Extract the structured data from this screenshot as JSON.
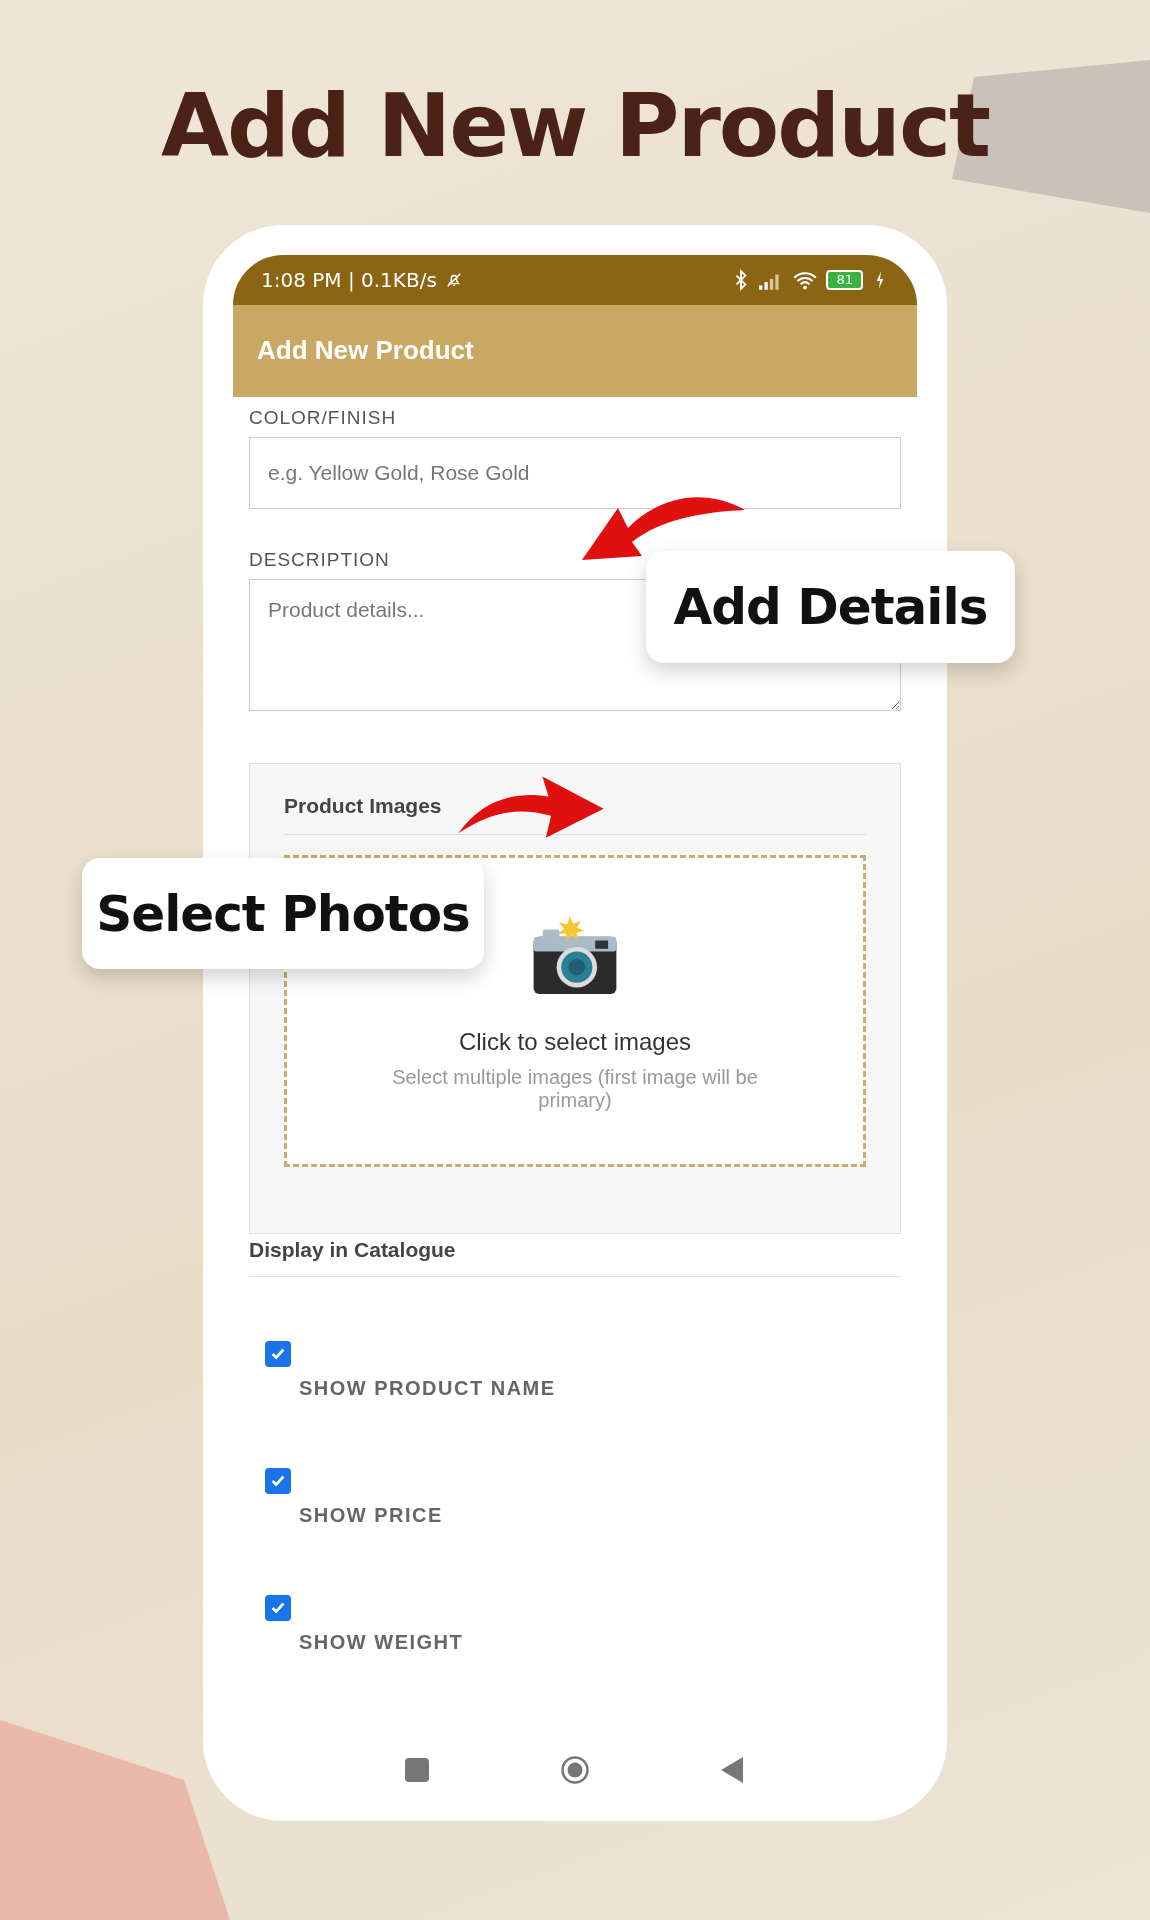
{
  "headline": "Add New Product",
  "status_bar": {
    "time": "1:08 PM | 0.1KB/s",
    "battery": "81"
  },
  "app_bar": {
    "title": "Add New Product"
  },
  "fields": [
    {
      "label": "COLOR/FINISH",
      "placeholder": "e.g. Yellow Gold, Rose Gold",
      "kind": "input"
    },
    {
      "label": "DESCRIPTION",
      "placeholder": "Product details...",
      "kind": "textarea"
    }
  ],
  "images_panel": {
    "title": "Product Images",
    "upload_title": "Click to select images",
    "upload_hint": "Select multiple images (first image will be primary)"
  },
  "catalogue": {
    "title": "Display in Catalogue",
    "options": [
      {
        "label": "SHOW PRODUCT NAME",
        "checked": true
      },
      {
        "label": "SHOW PRICE",
        "checked": true
      },
      {
        "label": "SHOW WEIGHT",
        "checked": true
      }
    ]
  },
  "callouts": [
    {
      "text": "Add Details",
      "kind": "details"
    },
    {
      "text": "Select Photos",
      "kind": "photos"
    }
  ]
}
